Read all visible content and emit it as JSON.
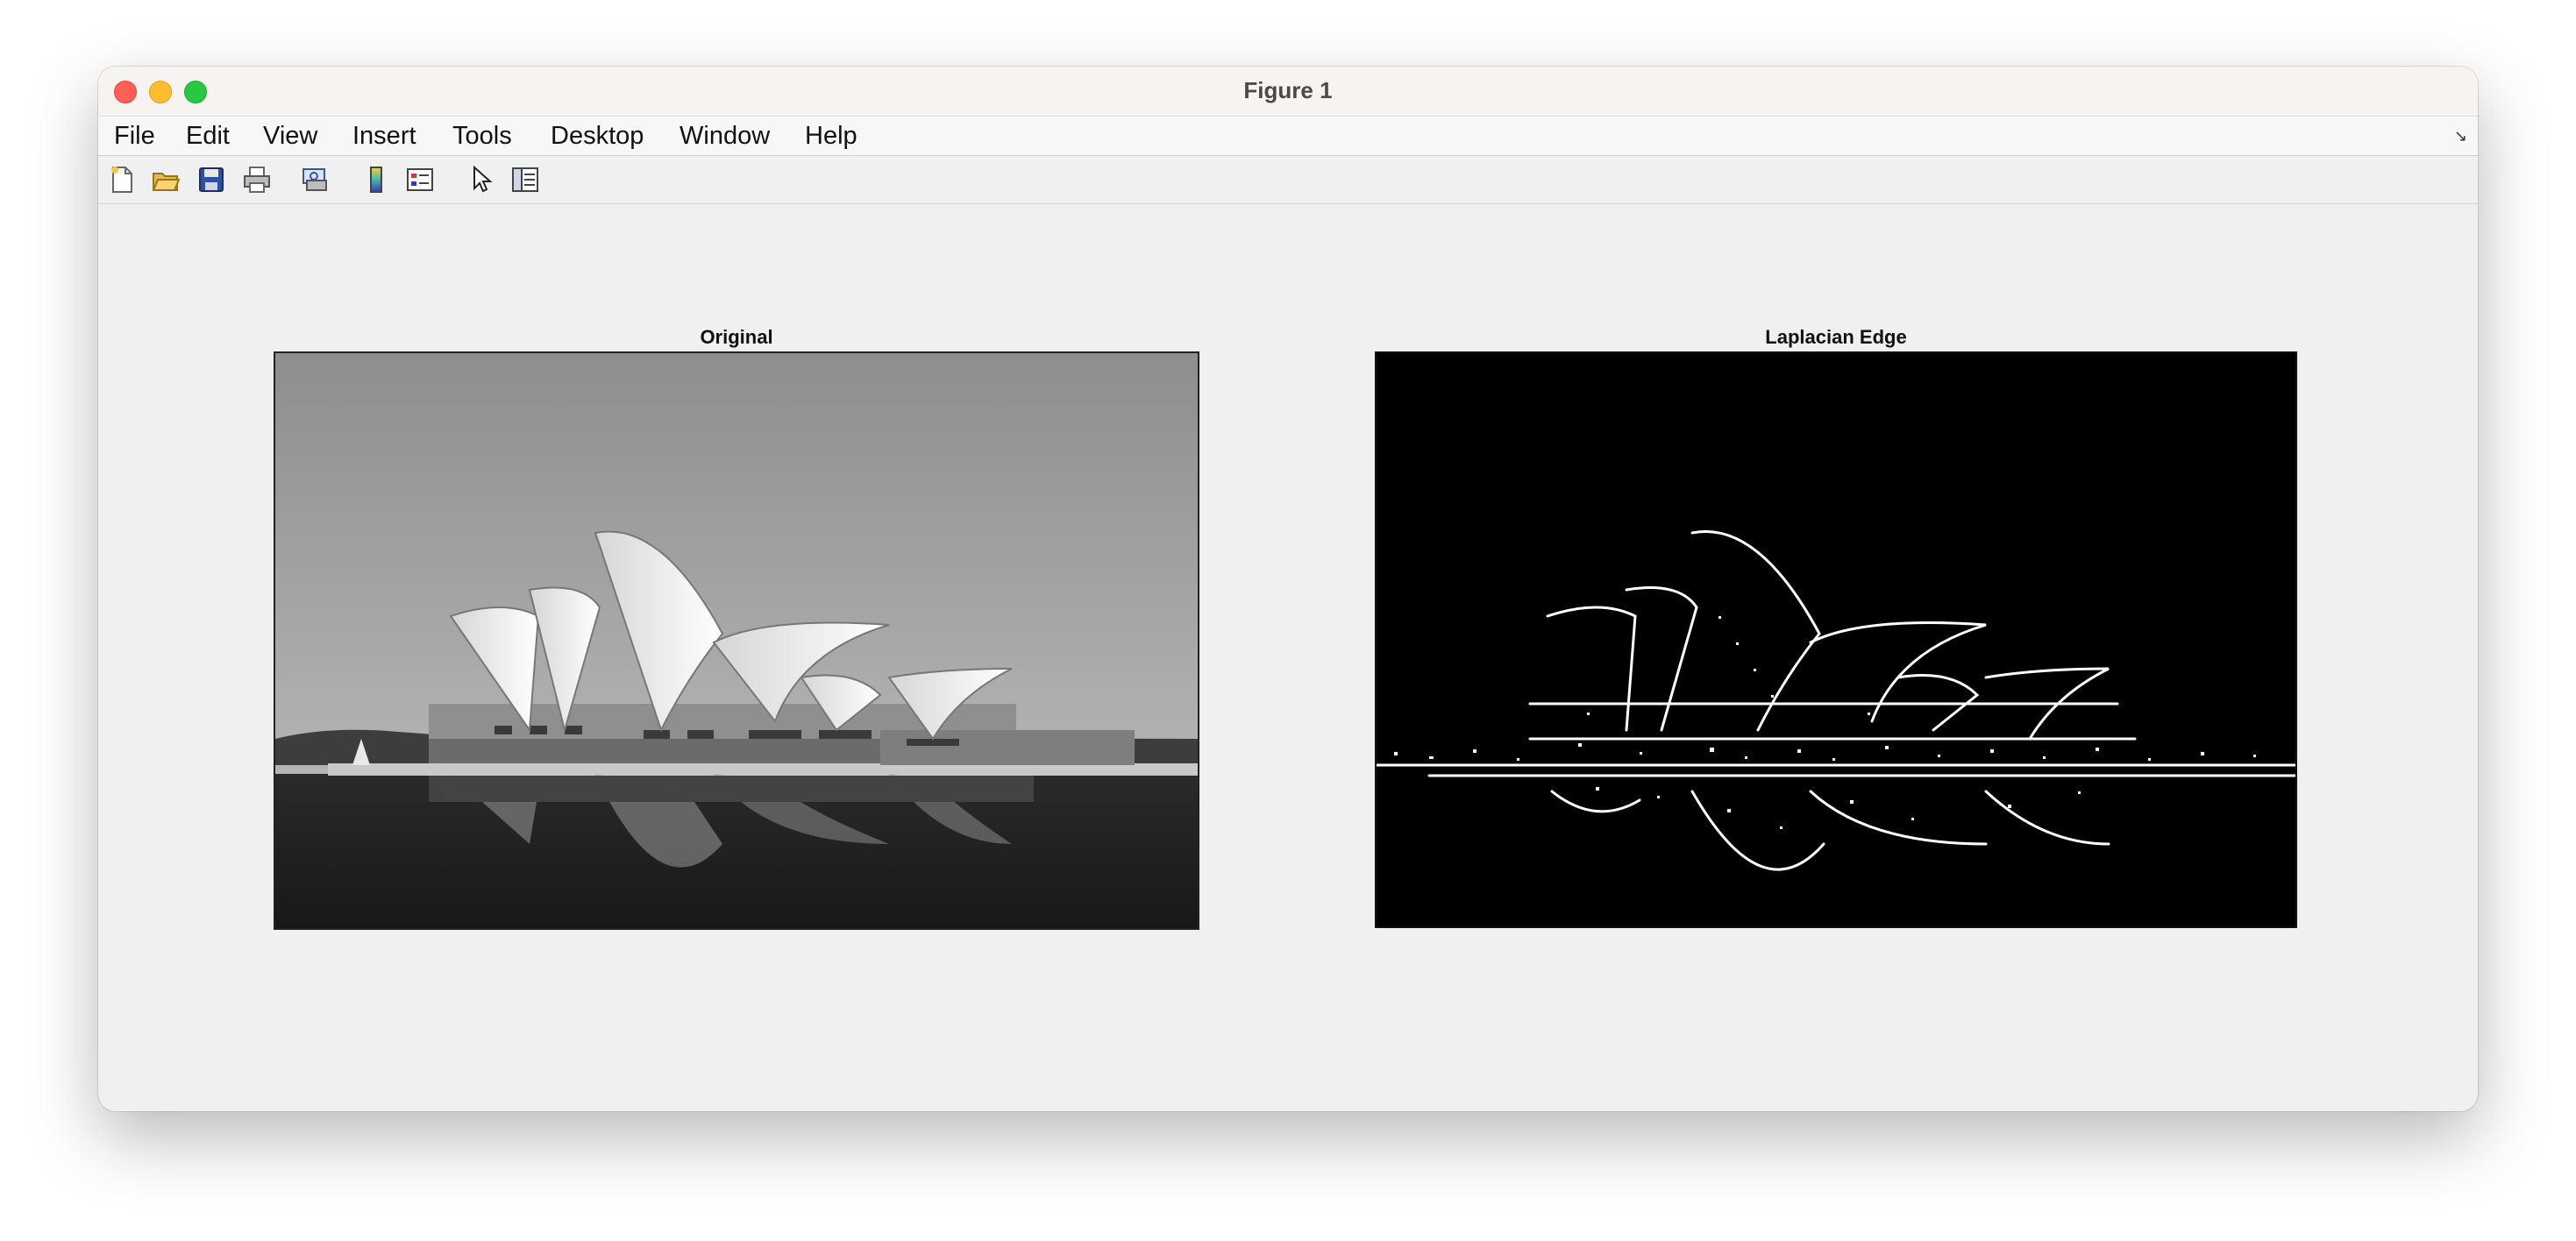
{
  "window": {
    "title": "Figure 1"
  },
  "menu": {
    "items": [
      "File",
      "Edit",
      "View",
      "Insert",
      "Tools",
      "Desktop",
      "Window",
      "Help"
    ]
  },
  "toolbar": {
    "tools": [
      {
        "name": "new-figure-icon"
      },
      {
        "name": "open-file-icon"
      },
      {
        "name": "save-icon"
      },
      {
        "name": "print-icon"
      },
      {
        "name": "print-preview-icon"
      },
      {
        "name": "colorbar-icon"
      },
      {
        "name": "legend-icon"
      },
      {
        "name": "edit-plot-pointer-icon"
      },
      {
        "name": "property-inspector-icon"
      }
    ]
  },
  "axes": {
    "left": {
      "title": "Original"
    },
    "right": {
      "title": "Laplacian Edge"
    }
  },
  "colors": {
    "window_bg": "#f0f0f0",
    "close": "#ff5f57",
    "minimize": "#febc2e",
    "maximize": "#28c840"
  }
}
